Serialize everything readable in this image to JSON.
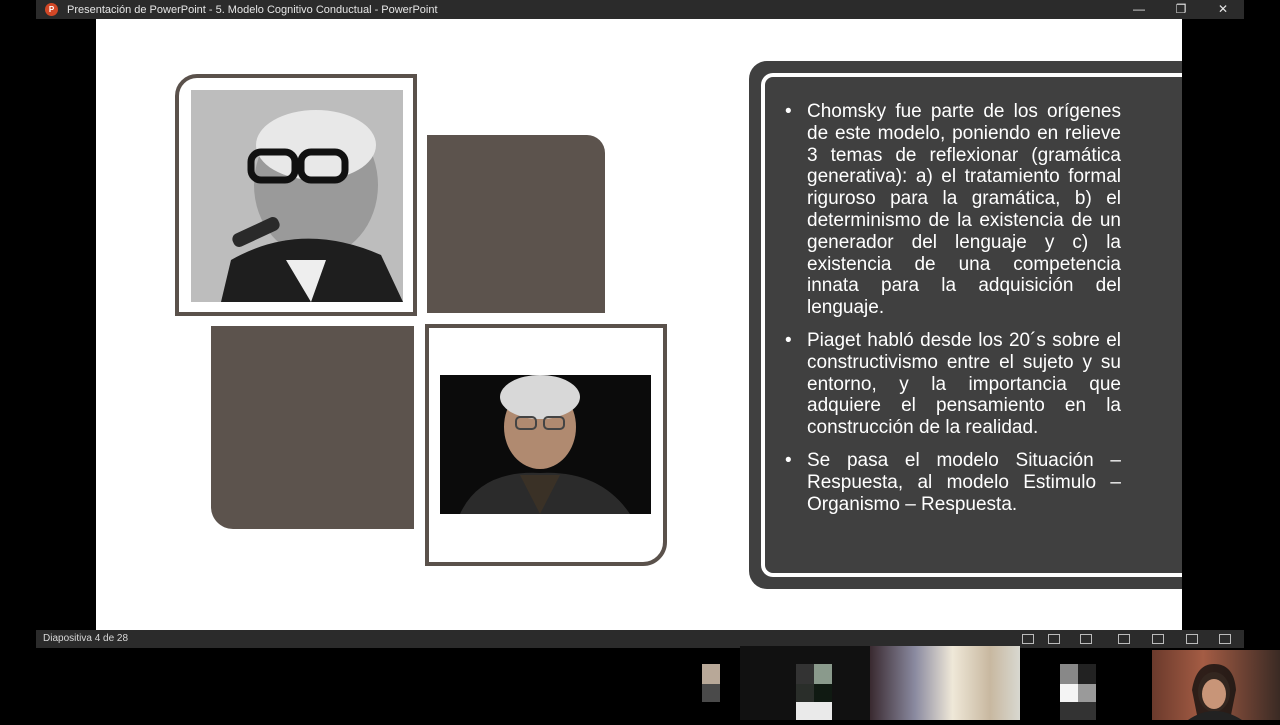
{
  "window": {
    "app_icon_letter": "P",
    "title": "Presentación de PowerPoint  -  5. Modelo Cognitivo Conductual - PowerPoint",
    "controls": [
      "—",
      "❐",
      "✕"
    ]
  },
  "slide": {
    "bullets": [
      "Chomsky fue parte de los orígenes de este modelo, poniendo en relieve 3 temas de reflexionar (gramática generativa): a) el tratamiento formal riguroso para la gramática, b) el determinismo de la existencia de un generador del lenguaje y c) la existencia de una competencia innata para la adquisición del lenguaje.",
      "Piaget habló desde los 20´s sobre el constructivismo entre el sujeto y su entorno, y la importancia que adquiere el pensamiento en la construcción de la realidad.",
      "Se pasa el modelo Situación – Respuesta, al modelo Estimulo – Organismo – Respuesta."
    ],
    "bullet_symbol": "•"
  },
  "status": {
    "slide_indicator": "Diapositiva 4 de 28"
  },
  "colors": {
    "accent_brown": "#5c534d",
    "panel_gray": "#404040",
    "powerpoint_red": "#d24726"
  }
}
